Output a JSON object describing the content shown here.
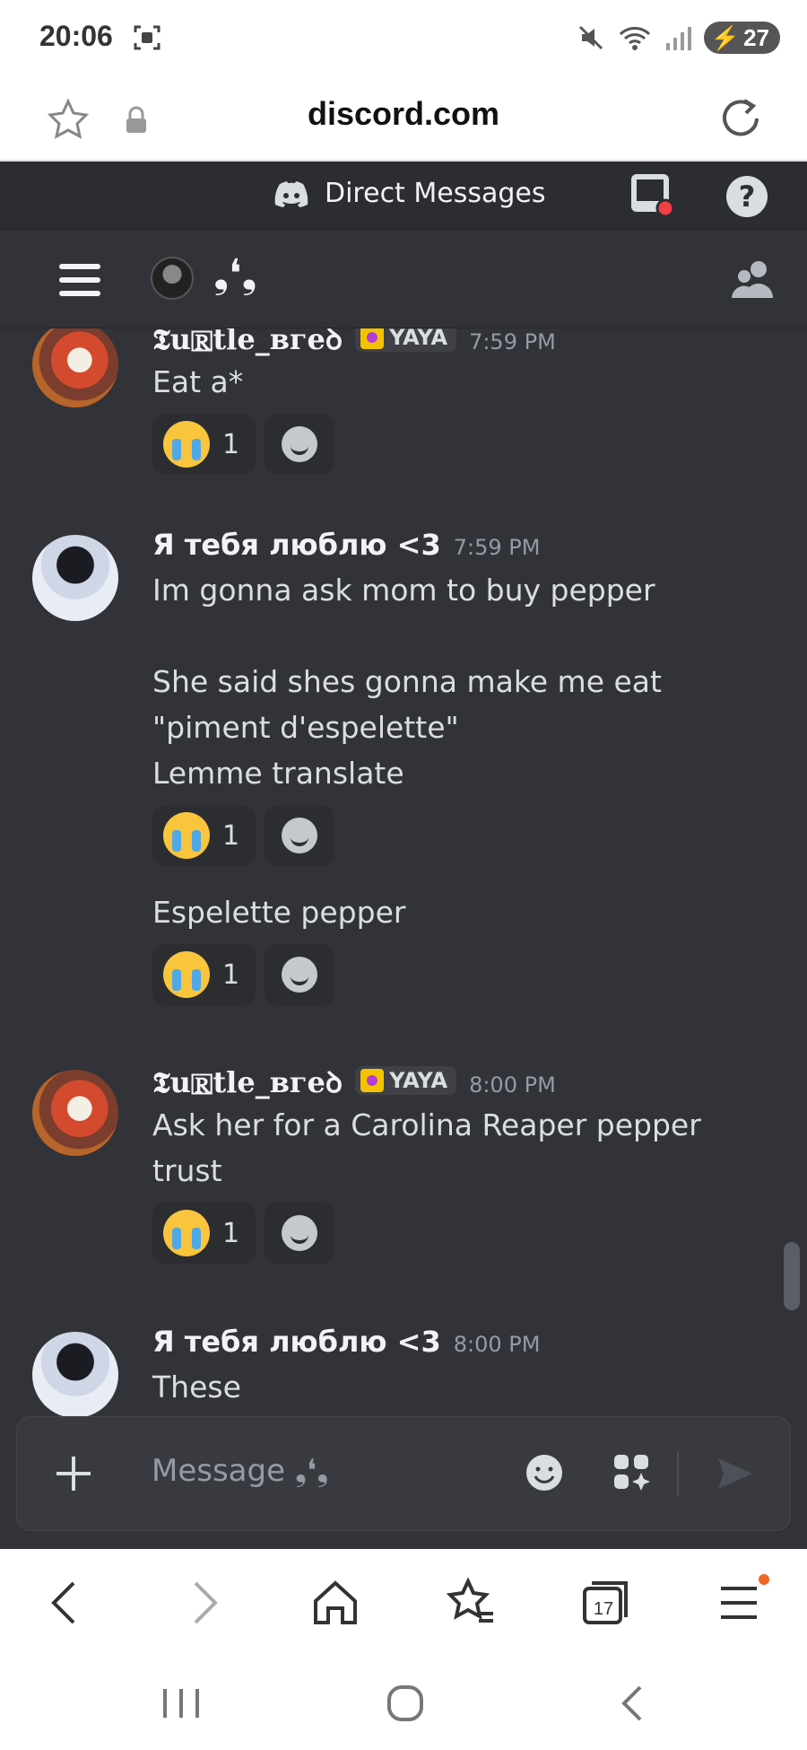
{
  "status_bar": {
    "time": "20:06",
    "battery": "27"
  },
  "browser": {
    "url": "discord.com",
    "tab_count": "17"
  },
  "discord": {
    "header_title": "Direct Messages",
    "help_label": "?",
    "channel_name": "❟❛❟",
    "composer_placeholder": "Message ❟❛❟"
  },
  "messages": [
    {
      "author": "𝕿u🅁tle_вгеꝺ",
      "tag": "YAYA",
      "time": "7:59 PM",
      "lines": [
        "Eat a*"
      ],
      "reaction_count": "1"
    },
    {
      "author": "Я тебя люблю <3",
      "time": "7:59 PM",
      "lines": [
        "Im gonna ask mom to buy pepper",
        "",
        "She said shes gonna make me eat",
        "\"piment d'espelette\"",
        "Lemme translate"
      ],
      "reaction_count": "1"
    },
    {
      "lines": [
        "Espelette pepper"
      ],
      "reaction_count": "1"
    },
    {
      "author": "𝕿u🅁tle_вгеꝺ",
      "tag": "YAYA",
      "time": "8:00 PM",
      "lines": [
        "Ask her for a Carolina Reaper pepper",
        "trust"
      ],
      "reaction_count": "1"
    },
    {
      "author": "Я тебя люблю <3",
      "time": "8:00 PM",
      "lines": [
        "These"
      ]
    }
  ],
  "colors": {
    "background": "#313338",
    "header": "#2b2d31",
    "composer": "#383a40",
    "text": "#dbdee1",
    "muted": "#949ba4",
    "notification_dot": "#f23f43",
    "browser_badge": "#f26522"
  }
}
